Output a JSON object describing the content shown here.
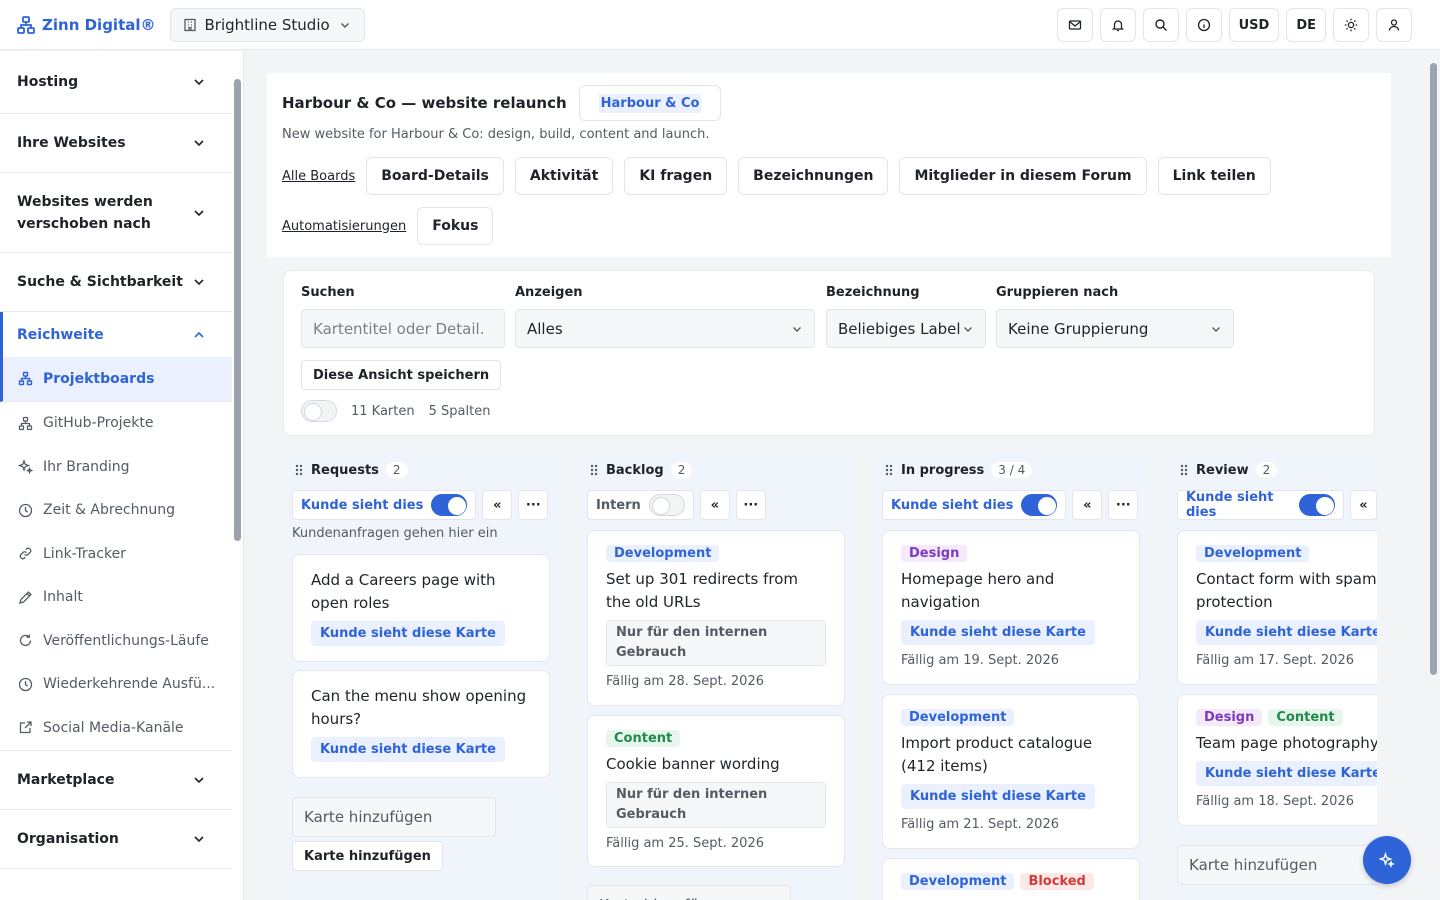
{
  "brand": {
    "name": "Zinn Digital®"
  },
  "org_switch": {
    "label": "Brightline Studio"
  },
  "top_actions": {
    "currency": "USD",
    "language": "DE"
  },
  "sidebar": {
    "sections": [
      {
        "label": "Hosting"
      },
      {
        "label": "Ihre Websites"
      },
      {
        "label": "Websites werden verschoben nach"
      },
      {
        "label": "Suche & Sichtbarkeit"
      },
      {
        "label": "Reichweite"
      },
      {
        "label": "Marketplace"
      },
      {
        "label": "Organisation"
      }
    ],
    "reach_items": [
      {
        "label": "Projektboards",
        "icon": "boards-icon"
      },
      {
        "label": "GitHub-Projekte",
        "icon": "github-icon"
      },
      {
        "label": "Ihr Branding",
        "icon": "sparkle-icon"
      },
      {
        "label": "Zeit & Abrechnung",
        "icon": "clock-icon"
      },
      {
        "label": "Link-Tracker",
        "icon": "link-icon"
      },
      {
        "label": "Inhalt",
        "icon": "pencil-icon"
      },
      {
        "label": "Veröffentlichungs-Läufe",
        "icon": "refresh-icon"
      },
      {
        "label": "Wiederkehrende Ausfü...",
        "icon": "clock-icon"
      },
      {
        "label": "Social Media-Kanäle",
        "icon": "external-icon"
      }
    ]
  },
  "board": {
    "title": "Harbour & Co — website relaunch",
    "client": "Harbour & Co",
    "description": "New website for Harbour & Co: design, build, content and launch.",
    "nav": {
      "all_boards": "Alle Boards",
      "details": "Board-Details",
      "activity": "Aktivität",
      "ask_ai": "KI fragen",
      "labels": "Bezeichnungen",
      "members": "Mitglieder in diesem Forum",
      "share": "Link teilen",
      "automations": "Automatisierungen",
      "focus": "Fokus"
    }
  },
  "filters": {
    "search_label": "Suchen",
    "search_placeholder": "Kartentitel oder Detail.",
    "show_label": "Anzeigen",
    "show_value": "Alles",
    "label_label": "Bezeichnung",
    "label_value": "Beliebiges Label",
    "group_label": "Gruppieren nach",
    "group_value": "Keine Gruppierung",
    "save_view": "Diese Ansicht speichern",
    "cards_count": "11 Karten",
    "columns_count": "5 Spalten"
  },
  "ui": {
    "client_sees": "Kunde sieht dies",
    "internal": "Intern",
    "collapse": "«",
    "more": "···",
    "client_sees_card": "Kunde sieht diese Karte",
    "internal_only": "Nur für den internen Gebrauch",
    "add_card_placeholder": "Karte hinzufügen",
    "add_card_button": "Karte hinzufügen"
  },
  "columns": [
    {
      "name": "Requests",
      "count": "2",
      "note": "Kundenanfragen gehen hier ein",
      "cards": [
        {
          "title": "Add a Careers page with open roles"
        },
        {
          "title": "Can the menu show opening hours?"
        }
      ]
    },
    {
      "name": "Backlog",
      "count": "2",
      "cards": [
        {
          "tag": "Development",
          "title": "Set up 301 redirects from the old URLs",
          "due": "Fällig am 28. Sept. 2026"
        },
        {
          "tag": "Content",
          "title": "Cookie banner wording",
          "due": "Fällig am 25. Sept. 2026"
        }
      ]
    },
    {
      "name": "In progress",
      "count": "3 / 4",
      "cards": [
        {
          "tag": "Design",
          "title": "Homepage hero and navigation",
          "due": "Fällig am 19. Sept. 2026"
        },
        {
          "tag": "Development",
          "title": "Import product catalogue (412 items)",
          "due": "Fällig am 21. Sept. 2026"
        },
        {
          "tags": [
            "Development",
            "Blocked"
          ]
        }
      ]
    },
    {
      "name": "Review",
      "count": "2",
      "cards": [
        {
          "tag": "Development",
          "title": "Contact form with spam protection",
          "due": "Fällig am 17. Sept. 2026"
        },
        {
          "tags": [
            "Design",
            "Content"
          ],
          "title": "Team page photography",
          "due": "Fällig am 18. Sept. 2026"
        }
      ]
    }
  ],
  "colors": {
    "accent": "#2f63d8",
    "design": "#7e3bbf",
    "content": "#1f8a4c",
    "blocked": "#d23b3b"
  }
}
